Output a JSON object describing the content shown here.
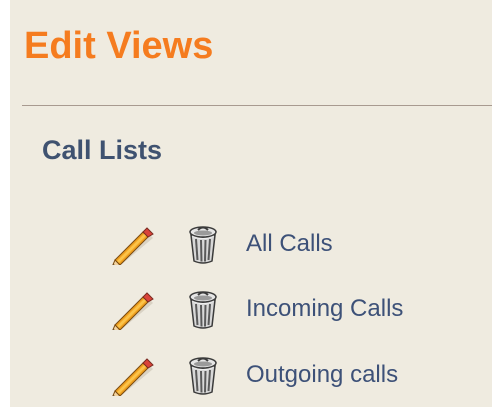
{
  "header": {
    "title": "Edit Views"
  },
  "section": {
    "title": "Call Lists"
  },
  "views": [
    {
      "label": "All Calls",
      "edit_icon": "pencil-icon",
      "delete_icon": "trash-can-icon"
    },
    {
      "label": "Incoming Calls",
      "edit_icon": "pencil-icon",
      "delete_icon": "trash-can-icon"
    },
    {
      "label": "Outgoing calls",
      "edit_icon": "pencil-icon",
      "delete_icon": "trash-can-icon"
    }
  ],
  "colors": {
    "title": "#f57c1f",
    "section_title": "#3f5270",
    "link": "#3d5178",
    "panel_background": "#efebe0"
  }
}
